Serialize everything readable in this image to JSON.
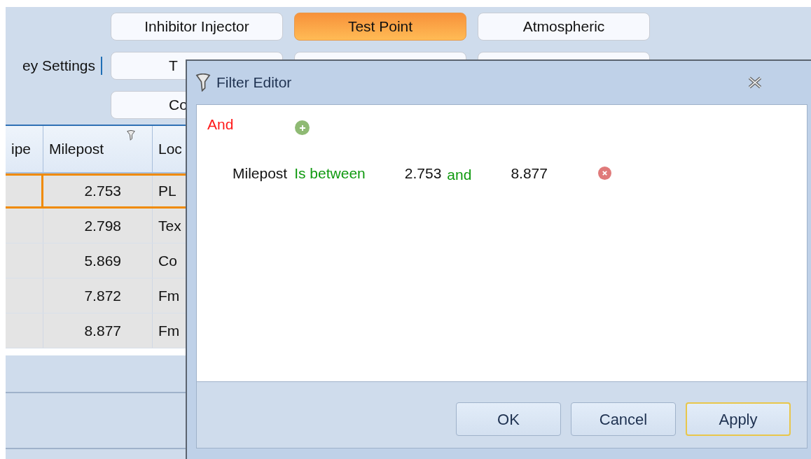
{
  "toolbar": {
    "section_label": "ey Settings",
    "buttons": [
      {
        "label": "Inhibitor Injector",
        "selected": false
      },
      {
        "label": "Test Point",
        "selected": true
      },
      {
        "label": "Atmospheric",
        "selected": false
      },
      {
        "label": "T",
        "selected": false,
        "kind": "partial"
      },
      {
        "selected": false
      },
      {
        "selected": false
      },
      {
        "label": "Co",
        "selected": false,
        "kind": "partial"
      }
    ]
  },
  "grid": {
    "columns": [
      "ipe",
      "Milepost",
      "Loc"
    ],
    "rows": [
      {
        "cells": [
          "",
          "2.753",
          "PL"
        ],
        "selected": true
      },
      {
        "cells": [
          "",
          "2.798",
          "Tex"
        ],
        "selected": false
      },
      {
        "cells": [
          "",
          "5.869",
          "Co"
        ],
        "selected": false
      },
      {
        "cells": [
          "",
          "7.872",
          "Fm"
        ],
        "selected": false
      },
      {
        "cells": [
          "",
          "8.877",
          "Fm"
        ],
        "selected": false
      }
    ]
  },
  "dialog": {
    "title": "Filter Editor",
    "group_operator": "And",
    "conditions": [
      {
        "field": "Milepost",
        "operator": "Is between",
        "value_1": "2.753",
        "joiner": "and",
        "value_2": "8.877"
      }
    ],
    "buttons": [
      {
        "label": "OK",
        "focused": false
      },
      {
        "label": "Cancel",
        "focused": false
      },
      {
        "label": "Apply",
        "focused": true
      }
    ]
  }
}
